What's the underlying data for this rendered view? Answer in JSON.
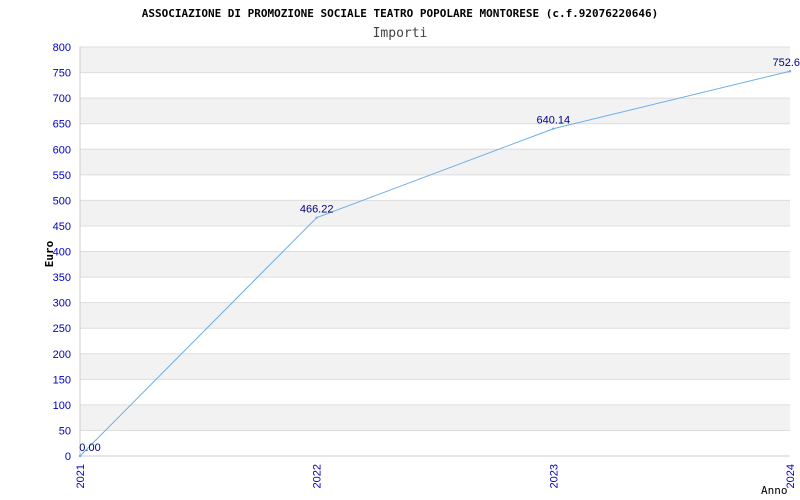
{
  "chart_data": {
    "type": "line",
    "title": "ASSOCIAZIONE DI PROMOZIONE SOCIALE TEATRO POPOLARE MONTORESE (c.f.92076220646)",
    "subtitle": "Importi",
    "xlabel": "Anno",
    "ylabel": "Euro",
    "categories": [
      "2021",
      "2022",
      "2023",
      "2024"
    ],
    "series": [
      {
        "values": [
          0.0,
          466.22,
          640.14,
          752.6
        ]
      }
    ],
    "data_labels": [
      "0.00",
      "466.22",
      "640.14",
      "752.6"
    ],
    "ylim": [
      0,
      800
    ],
    "yticks": [
      0,
      50,
      100,
      150,
      200,
      250,
      300,
      350,
      400,
      450,
      500,
      550,
      600,
      650,
      700,
      750,
      800
    ],
    "grid": true,
    "banded_background": true,
    "colors": {
      "line": "#6aaee8",
      "tick_text": "#0000c0",
      "data_label": "#000080",
      "title_text": "#000000",
      "subtitle_text": "#444444",
      "band": "#f2f2f2",
      "grid": "#dddddd"
    }
  }
}
